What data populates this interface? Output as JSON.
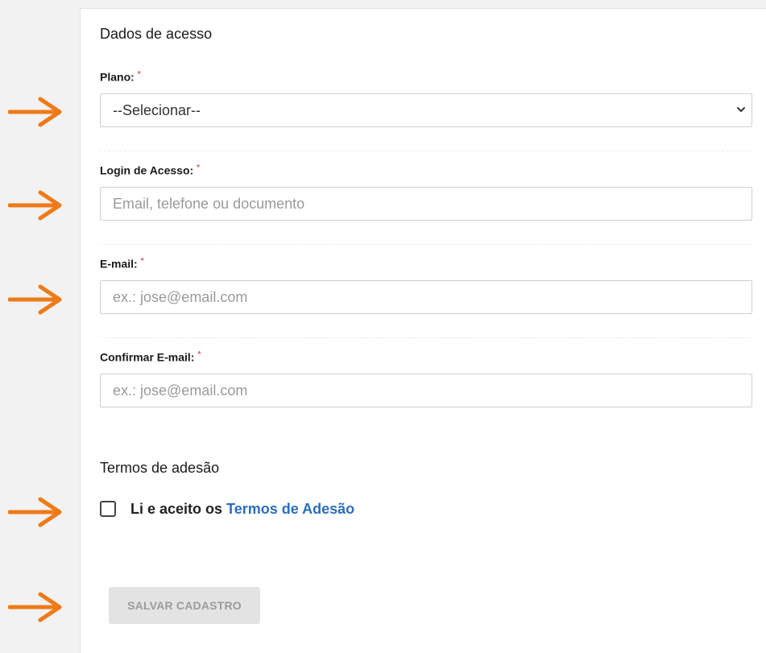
{
  "access_section": {
    "title": "Dados de acesso"
  },
  "fields": {
    "plano": {
      "label": "Plano:",
      "required_mark": "*",
      "selected": "--Selecionar--"
    },
    "login": {
      "label": "Login de Acesso:",
      "required_mark": "*",
      "value": "",
      "placeholder": "Email, telefone ou documento"
    },
    "email": {
      "label": "E-mail:",
      "required_mark": "*",
      "value": "",
      "placeholder": "ex.: jose@email.com"
    },
    "confirm_email": {
      "label": "Confirmar E-mail:",
      "required_mark": "*",
      "value": "",
      "placeholder": "ex.: jose@email.com"
    }
  },
  "terms_section": {
    "title": "Termos de adesão",
    "checkbox_checked": false,
    "text": "Li e aceito os ",
    "link_text": "Termos de Adesão"
  },
  "actions": {
    "save_label": "SALVAR CADASTRO"
  },
  "colors": {
    "arrow": "#ee7a18",
    "link": "#2a6ebd",
    "required": "#e05a4a",
    "disabled_button_bg": "#e3e3e3"
  }
}
